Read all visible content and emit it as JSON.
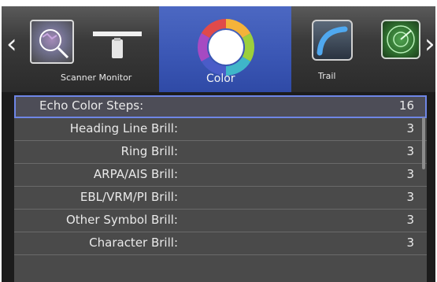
{
  "navigation": {
    "left_arrow": "‹",
    "right_arrow": "›"
  },
  "tabs": [
    {
      "id": "scanner",
      "label": "Scanner Monitor",
      "icon": "scanner-icon",
      "selected": false
    },
    {
      "id": "color",
      "label": "Color",
      "icon": "color-wheel-icon",
      "selected": true
    },
    {
      "id": "trail",
      "label": "Trail",
      "icon": "trail-icon",
      "selected": false
    },
    {
      "id": "radar",
      "label": "",
      "icon": "radar-icon",
      "selected": false
    }
  ],
  "colors": {
    "selected_tab": "#3a56b4",
    "selection_outline": "#6e86e6",
    "list_background": "#4a4a4a",
    "text": "#e9e9e9"
  },
  "settings": [
    {
      "label": "Echo Color Steps:",
      "value": "16",
      "selected": true
    },
    {
      "label": "Heading Line Brill:",
      "value": "3",
      "selected": false
    },
    {
      "label": "Ring Brill:",
      "value": "3",
      "selected": false
    },
    {
      "label": "ARPA/AIS Brill:",
      "value": "3",
      "selected": false
    },
    {
      "label": "EBL/VRM/PI Brill:",
      "value": "3",
      "selected": false
    },
    {
      "label": "Other Symbol Brill:",
      "value": "3",
      "selected": false
    },
    {
      "label": "Character Brill:",
      "value": "3",
      "selected": false
    }
  ]
}
